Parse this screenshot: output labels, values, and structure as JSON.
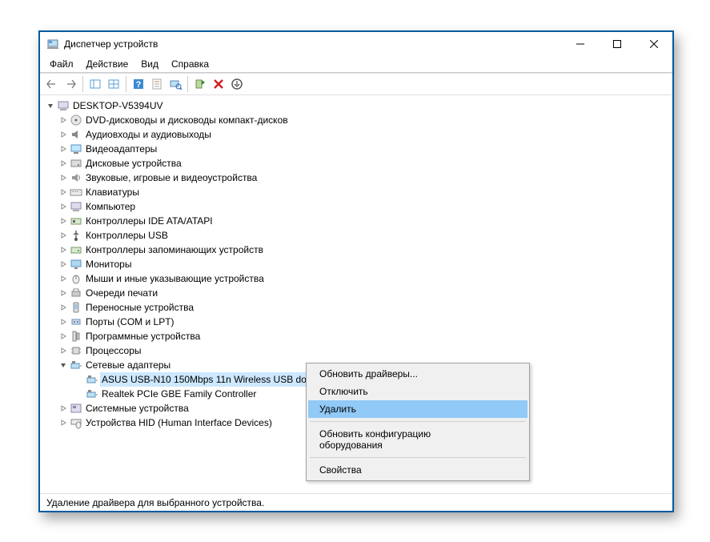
{
  "window": {
    "title": "Диспетчер устройств"
  },
  "menubar": {
    "file": "Файл",
    "action": "Действие",
    "view": "Вид",
    "help": "Справка"
  },
  "tree": {
    "root": "DESKTOP-V5394UV",
    "categories": [
      "DVD-дисководы и дисководы компакт-дисков",
      "Аудиовходы и аудиовыходы",
      "Видеоадаптеры",
      "Дисковые устройства",
      "Звуковые, игровые и видеоустройства",
      "Клавиатуры",
      "Компьютер",
      "Контроллеры IDE ATA/ATAPI",
      "Контроллеры USB",
      "Контроллеры запоминающих устройств",
      "Мониторы",
      "Мыши и иные указывающие устройства",
      "Очереди печати",
      "Переносные устройства",
      "Порты (COM и LPT)",
      "Программные устройства",
      "Процессоры"
    ],
    "network_label": "Сетевые адаптеры",
    "network_children": [
      "ASUS USB-N10 150Mbps 11n Wireless USB do",
      "Realtek PCIe GBE Family Controller"
    ],
    "after_categories": [
      "Системные устройства",
      "Устройства HID (Human Interface Devices)"
    ]
  },
  "context_menu": {
    "update": "Обновить драйверы...",
    "disable": "Отключить",
    "uninstall": "Удалить",
    "scan": "Обновить конфигурацию оборудования",
    "properties": "Свойства"
  },
  "statusbar": {
    "text": "Удаление драйвера для выбранного устройства."
  }
}
